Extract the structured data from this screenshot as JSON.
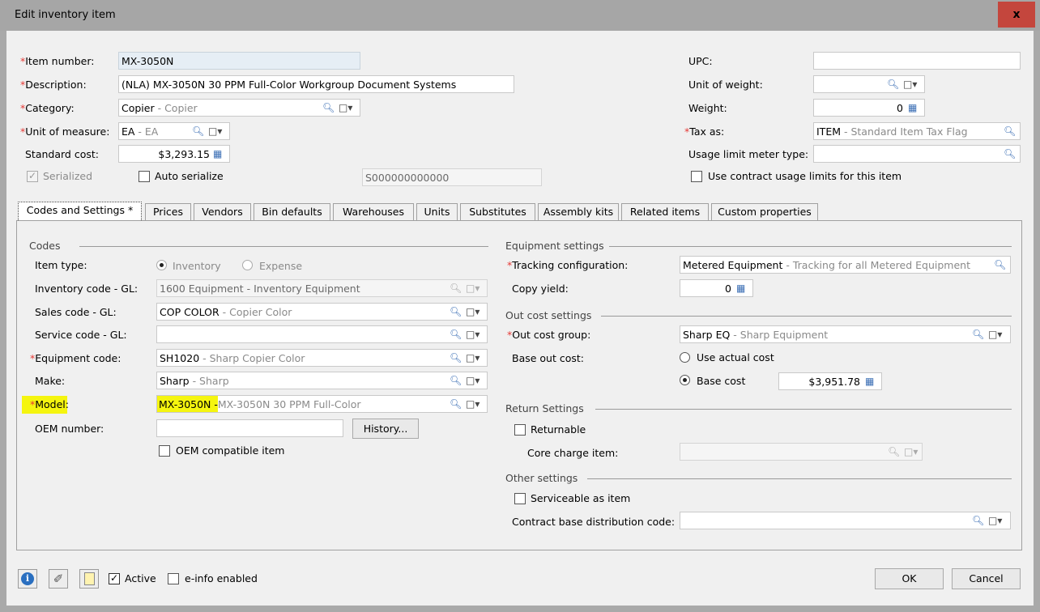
{
  "window": {
    "title": "Edit inventory item",
    "close_label": "x"
  },
  "header": {
    "item_number": {
      "label": "Item number:",
      "value": "MX-3050N"
    },
    "description": {
      "label": "Description:",
      "value": "(NLA) MX-3050N 30 PPM Full-Color Workgroup Document Systems"
    },
    "category": {
      "label": "Category:",
      "code": "Copier",
      "desc": " - Copier"
    },
    "unit_of_measure": {
      "label": "Unit of measure:",
      "code": "EA",
      "desc": " - EA"
    },
    "standard_cost": {
      "label": "Standard cost:",
      "value": "$3,293.15"
    },
    "serialized": {
      "label": "Serialized",
      "checked": true,
      "disabled": true
    },
    "auto_serialize": {
      "label": "Auto serialize",
      "checked": false
    },
    "serial_value": "S000000000000",
    "upc": {
      "label": "UPC:",
      "value": ""
    },
    "unit_of_weight": {
      "label": "Unit of weight:",
      "value": ""
    },
    "weight": {
      "label": "Weight:",
      "value": "0"
    },
    "tax_as": {
      "label": "Tax as:",
      "code": "ITEM",
      "desc": " - Standard Item Tax Flag"
    },
    "usage_limit_meter_type": {
      "label": "Usage limit meter type:",
      "value": ""
    },
    "use_contract_usage": {
      "label": "Use contract usage limits for this item",
      "checked": false
    }
  },
  "tabs": [
    "Codes and Settings *",
    "Prices",
    "Vendors",
    "Bin defaults",
    "Warehouses",
    "Units",
    "Substitutes",
    "Assembly kits",
    "Related items",
    "Custom properties"
  ],
  "codes": {
    "section_title": "Codes",
    "item_type": {
      "label": "Item type:",
      "option_inventory": "Inventory",
      "option_expense": "Expense",
      "selected": "Inventory"
    },
    "inventory_code": {
      "label": "Inventory code - GL:",
      "code": "1600 Equipment",
      "desc": " - Inventory Equipment"
    },
    "sales_code": {
      "label": "Sales code - GL:",
      "code": "COP COLOR",
      "desc": " - Copier Color"
    },
    "service_code": {
      "label": "Service code - GL:",
      "code": "",
      "desc": ""
    },
    "equipment_code": {
      "label": "Equipment code:",
      "code": "SH1020",
      "desc": " - Sharp Copier Color"
    },
    "make": {
      "label": "Make:",
      "code": "Sharp",
      "desc": " - Sharp"
    },
    "model": {
      "label": "Model:",
      "code": "MX-3050N - ",
      "desc": "MX-3050N 30 PPM Full-Color"
    },
    "oem_number": {
      "label": "OEM number:",
      "value": ""
    },
    "history_button": "History...",
    "oem_compatible": {
      "label": "OEM compatible item",
      "checked": false
    }
  },
  "equipment_settings": {
    "section_title": "Equipment settings",
    "tracking_configuration": {
      "label": "Tracking configuration:",
      "code": "Metered Equipment",
      "desc": " - Tracking for all Metered Equipment"
    },
    "copy_yield": {
      "label": "Copy yield:",
      "value": "0"
    }
  },
  "out_cost_settings": {
    "section_title": "Out cost settings",
    "out_cost_group": {
      "label": "Out cost group:",
      "code": "Sharp EQ",
      "desc": " - Sharp Equipment"
    },
    "base_out_cost": {
      "label": "Base out cost:",
      "option_actual": "Use actual cost",
      "option_base": "Base cost",
      "selected": "Base cost",
      "base_cost_value": "$3,951.78"
    }
  },
  "return_settings": {
    "section_title": "Return Settings",
    "returnable": {
      "label": "Returnable",
      "checked": false
    },
    "core_charge_item": {
      "label": "Core charge item:",
      "value": ""
    }
  },
  "other_settings": {
    "section_title": "Other settings",
    "serviceable": {
      "label": "Serviceable as item",
      "checked": false
    },
    "contract_base_distribution": {
      "label": "Contract base distribution code:",
      "value": ""
    }
  },
  "footer": {
    "active": {
      "label": "Active",
      "checked": true
    },
    "einfo": {
      "label": "e-info enabled",
      "checked": false
    },
    "ok_label": "OK",
    "cancel_label": "Cancel"
  },
  "required_marker": "*",
  "colors": {
    "required": "#e53935",
    "highlight": "#f5f50f",
    "close_button": "#c4463d",
    "link_icon": "#3c6fb5"
  }
}
